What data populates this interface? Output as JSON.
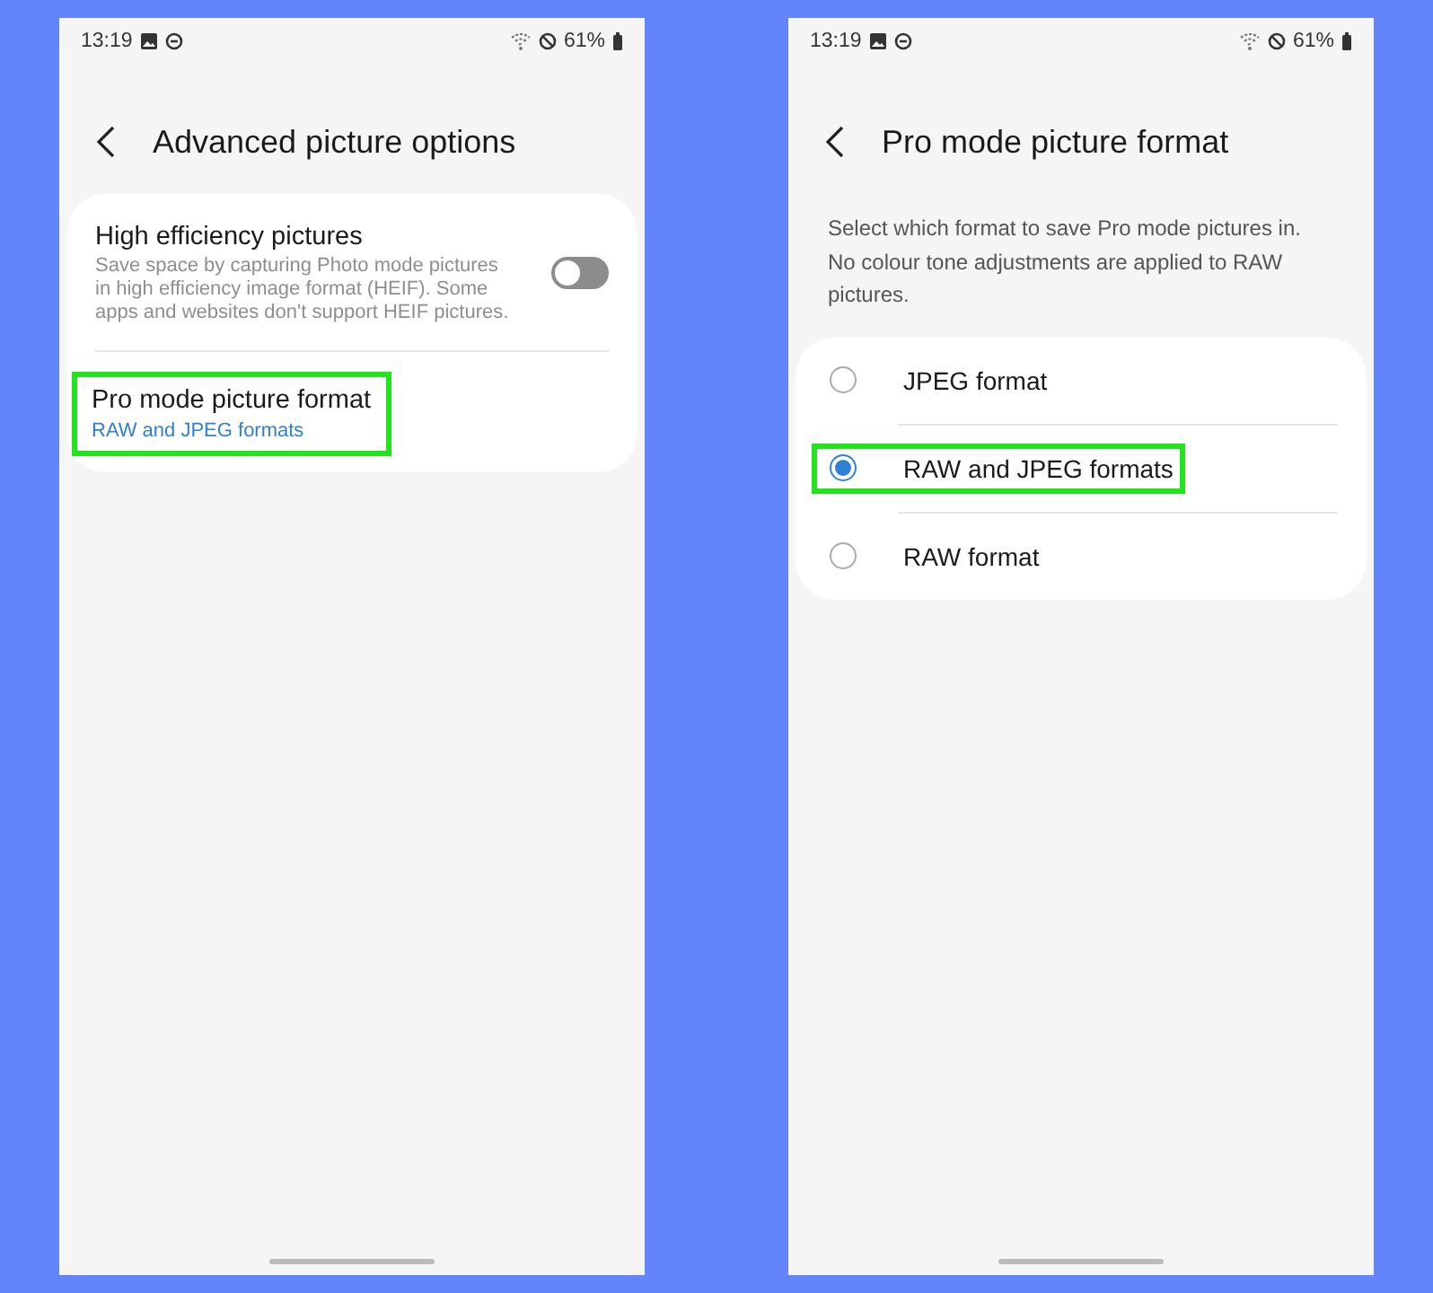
{
  "screens": [
    {
      "status_bar": {
        "time": "13:19",
        "battery": "61%"
      },
      "title": "Advanced picture options",
      "settings": [
        {
          "kind": "switch",
          "title": "High efficiency pictures",
          "summary": "Save space by capturing Photo mode pictures in high efficiency image format (HEIF). Some apps and websites don't support HEIF pictures.",
          "on": false,
          "highlighted": false
        },
        {
          "kind": "link",
          "title": "Pro mode picture format",
          "value": "RAW and JPEG formats",
          "highlighted": true
        }
      ]
    },
    {
      "status_bar": {
        "time": "13:19",
        "battery": "61%"
      },
      "title": "Pro mode picture format",
      "description": "Select which format to save Pro mode pictures in. No colour tone adjustments are applied to RAW pictures.",
      "options": [
        {
          "label": "JPEG format",
          "selected": false,
          "highlighted": false
        },
        {
          "label": "RAW and JPEG formats",
          "selected": true,
          "highlighted": true
        },
        {
          "label": "RAW format",
          "selected": false,
          "highlighted": false
        }
      ]
    }
  ]
}
